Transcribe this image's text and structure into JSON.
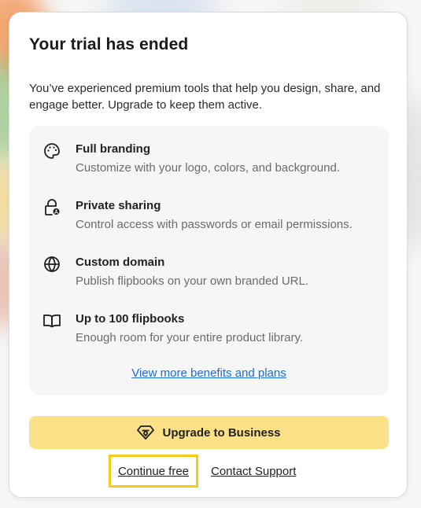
{
  "modal": {
    "title": "Your trial has ended",
    "description": "You’ve experienced premium tools that help you design, share, and engage better. Upgrade to keep them active."
  },
  "benefits": [
    {
      "icon": "palette-icon",
      "title": "Full branding",
      "description": "Customize with your logo, colors, and background."
    },
    {
      "icon": "lock-icon",
      "title": "Private sharing",
      "description": "Control access with passwords or email permissions."
    },
    {
      "icon": "globe-icon",
      "title": "Custom domain",
      "description": "Publish flipbooks on your own branded URL."
    },
    {
      "icon": "book-icon",
      "title": "Up to 100 flipbooks",
      "description": "Enough room for your entire product library."
    }
  ],
  "more_link": "View more benefits and plans",
  "actions": {
    "upgrade_label": "Upgrade to Business",
    "upgrade_icon": "diamond-icon",
    "continue_free_label": "Continue free",
    "contact_support_label": "Contact Support"
  },
  "colors": {
    "upgrade_button": "#fde188",
    "link": "#1a6ed8",
    "highlight_outline": "#f5cb1c",
    "benefits_panel": "#f6f6f6"
  }
}
